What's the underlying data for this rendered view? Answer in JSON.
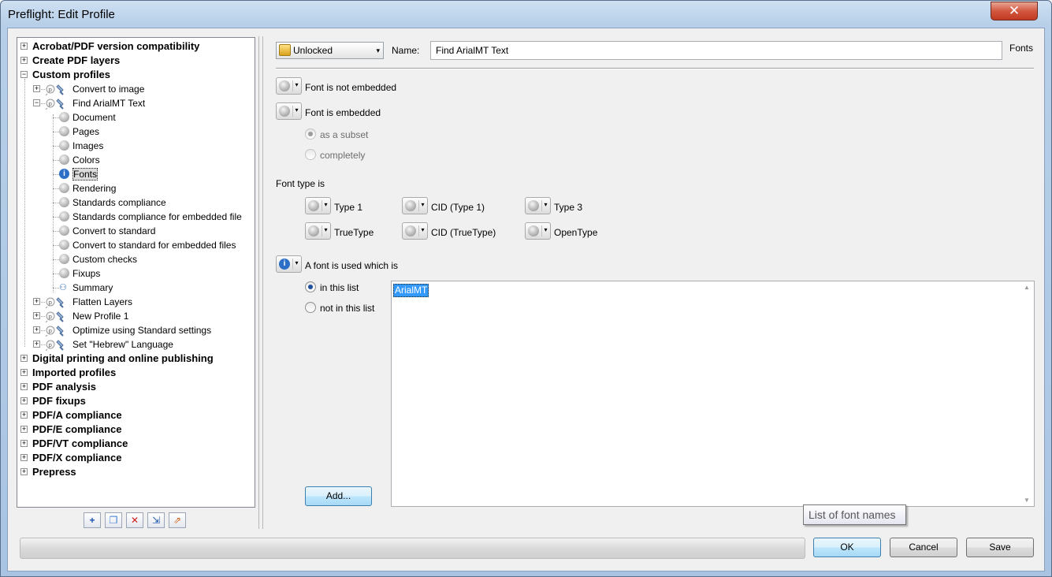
{
  "window": {
    "title": "Preflight: Edit Profile",
    "close_glyph": "✕"
  },
  "tree": {
    "items": [
      {
        "label": "Acrobat/PDF version compatibility",
        "level": 0,
        "bold": true,
        "expander": "+"
      },
      {
        "label": "Create PDF layers",
        "level": 0,
        "bold": true,
        "expander": "+"
      },
      {
        "label": "Custom profiles",
        "level": 0,
        "bold": true,
        "expander": "−"
      },
      {
        "label": "Convert to image",
        "level": 1,
        "icon": "profile-icon",
        "expander": "+"
      },
      {
        "label": "Find ArialMT Text",
        "level": 1,
        "icon": "profile-icon",
        "expander": "−"
      },
      {
        "label": "Document",
        "level": 2,
        "icon": "gray-dot-icon"
      },
      {
        "label": "Pages",
        "level": 2,
        "icon": "gray-dot-icon"
      },
      {
        "label": "Images",
        "level": 2,
        "icon": "gray-dot-icon"
      },
      {
        "label": "Colors",
        "level": 2,
        "icon": "gray-dot-icon"
      },
      {
        "label": "Fonts",
        "level": 2,
        "icon": "info-icon",
        "selected": true
      },
      {
        "label": "Rendering",
        "level": 2,
        "icon": "gray-dot-icon"
      },
      {
        "label": "Standards compliance",
        "level": 2,
        "icon": "gray-dot-icon"
      },
      {
        "label": "Standards compliance for embedded file",
        "level": 2,
        "icon": "gray-dot-icon"
      },
      {
        "label": "Convert to standard",
        "level": 2,
        "icon": "gray-dot-icon"
      },
      {
        "label": "Convert to standard for embedded files",
        "level": 2,
        "icon": "gray-dot-icon"
      },
      {
        "label": "Custom checks",
        "level": 2,
        "icon": "gray-dot-icon"
      },
      {
        "label": "Fixups",
        "level": 2,
        "icon": "gray-dot-icon"
      },
      {
        "label": "Summary",
        "level": 2,
        "icon": "hierarchy-icon"
      },
      {
        "label": "Flatten Layers",
        "level": 1,
        "icon": "profile-icon",
        "expander": "+"
      },
      {
        "label": "New Profile 1",
        "level": 1,
        "icon": "profile-icon",
        "expander": "+"
      },
      {
        "label": "Optimize using Standard settings",
        "level": 1,
        "icon": "profile-icon",
        "expander": "+"
      },
      {
        "label": "Set \"Hebrew\" Language",
        "level": 1,
        "icon": "profile-icon",
        "expander": "+"
      },
      {
        "label": "Digital printing and online publishing",
        "level": 0,
        "bold": true,
        "expander": "+"
      },
      {
        "label": "Imported profiles",
        "level": 0,
        "bold": true,
        "expander": "+"
      },
      {
        "label": "PDF analysis",
        "level": 0,
        "bold": true,
        "expander": "+"
      },
      {
        "label": "PDF fixups",
        "level": 0,
        "bold": true,
        "expander": "+"
      },
      {
        "label": "PDF/A compliance",
        "level": 0,
        "bold": true,
        "expander": "+"
      },
      {
        "label": "PDF/E compliance",
        "level": 0,
        "bold": true,
        "expander": "+"
      },
      {
        "label": "PDF/VT compliance",
        "level": 0,
        "bold": true,
        "expander": "+"
      },
      {
        "label": "PDF/X compliance",
        "level": 0,
        "bold": true,
        "expander": "+"
      },
      {
        "label": "Prepress",
        "level": 0,
        "bold": true,
        "expander": "+"
      }
    ],
    "toolbar": [
      "add-profile-icon",
      "duplicate-icon",
      "delete-icon",
      "import-icon",
      "export-icon"
    ]
  },
  "editor": {
    "lock_label": "Unlocked",
    "name_label": "Name:",
    "name_value": "Find ArialMT Text",
    "section_label": "Fonts",
    "font_not_embedded": "Font is not embedded",
    "font_embedded": "Font is embedded",
    "as_subset": "as a subset",
    "completely": "completely",
    "font_type_is": "Font type is",
    "font_types": [
      "Type 1",
      "CID (Type 1)",
      "Type 3",
      "TrueType",
      "CID (TrueType)",
      "OpenType"
    ],
    "font_used_which_is": "A font is used which is",
    "in_this_list": "in this list",
    "not_in_this_list": "not in this list",
    "font_list": [
      "ArialMT"
    ],
    "add_button": "Add...",
    "tooltip": "List of font names"
  },
  "footer": {
    "ok": "OK",
    "cancel": "Cancel",
    "save": "Save"
  },
  "colors": {
    "selection": "#3399ff",
    "info_icon": "#2d6fc7",
    "default_button_border": "#3c7fb1"
  }
}
